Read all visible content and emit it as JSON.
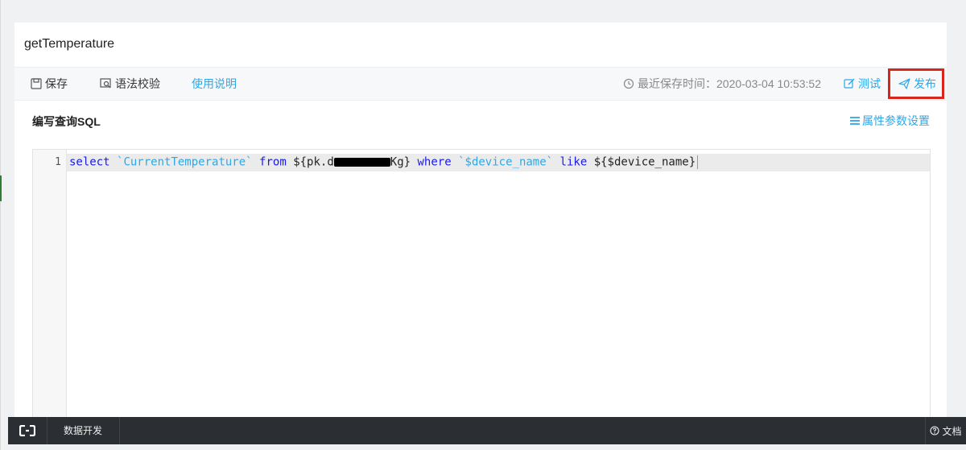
{
  "panel": {
    "title": "getTemperature"
  },
  "toolbar": {
    "save_label": "保存",
    "check_label": "语法校验",
    "help_label": "使用说明",
    "last_saved_label": "最近保存时间：2020-03-04 10:53:52",
    "test_label": "测试",
    "publish_label": "发布"
  },
  "section": {
    "label": "编写查询SQL",
    "attr_settings_label": "属性参数设置"
  },
  "editor": {
    "line_number": "1",
    "tokens": {
      "select": "select",
      "field": "`CurrentTemperature`",
      "from": "from",
      "pk_prefix": "${pk.d",
      "pk_suffix": "Kg}",
      "where": "where",
      "device_field": "`$device_name`",
      "like": "like",
      "param": "${$device_name}"
    }
  },
  "bottom_bar": {
    "tab_label": "数据开发",
    "docs_label": "文档"
  },
  "colors": {
    "accent": "#2ea8e6",
    "highlight_box": "#d9261c",
    "keyword": "#1a1ae6",
    "bottom_bar": "#2b2e33"
  }
}
